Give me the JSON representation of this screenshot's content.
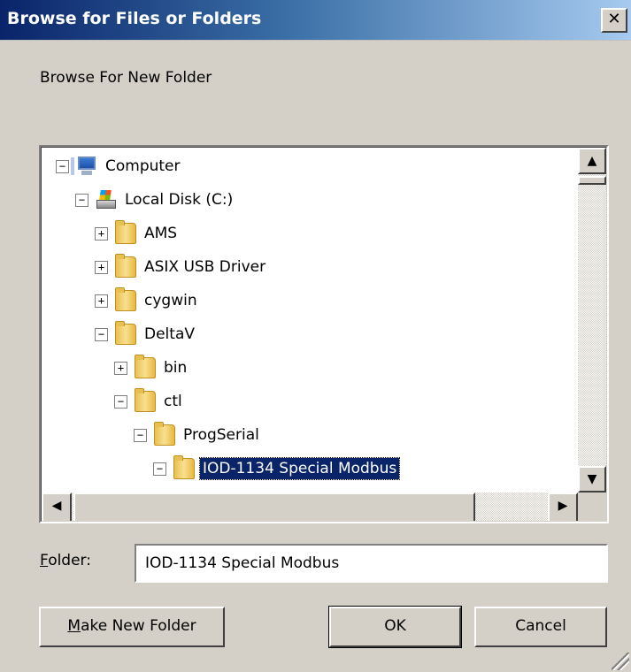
{
  "window": {
    "title": "Browse for Files or Folders",
    "close_glyph": "✕"
  },
  "instruction": "Browse For New Folder",
  "tree": {
    "nodes": [
      {
        "label": "Computer",
        "expander": "−",
        "icon": "computer-icon",
        "level": 0
      },
      {
        "label": "Local Disk (C:)",
        "expander": "−",
        "icon": "local-disk-icon",
        "level": 1
      },
      {
        "label": "AMS",
        "expander": "+",
        "icon": "folder-icon",
        "level": 2
      },
      {
        "label": "ASIX USB Driver",
        "expander": "+",
        "icon": "folder-icon",
        "level": 2
      },
      {
        "label": "cygwin",
        "expander": "+",
        "icon": "folder-icon",
        "level": 2
      },
      {
        "label": "DeltaV",
        "expander": "−",
        "icon": "folder-icon",
        "level": 2
      },
      {
        "label": "bin",
        "expander": "+",
        "icon": "folder-icon",
        "level": 3
      },
      {
        "label": "ctl",
        "expander": "−",
        "icon": "folder-icon",
        "level": 3
      },
      {
        "label": "ProgSerial",
        "expander": "−",
        "icon": "folder-icon",
        "level": 4
      },
      {
        "label": "IOD-1134 Special Modbus",
        "expander": "−",
        "icon": "folder-icon",
        "level": 5,
        "selected": true
      }
    ],
    "scroll_up_glyph": "▲",
    "scroll_down_glyph": "▼",
    "scroll_left_glyph": "◀",
    "scroll_right_glyph": "▶"
  },
  "folder_field": {
    "label_prefix": "F",
    "label_rest": "older:",
    "value": "IOD-1134 Special Modbus"
  },
  "buttons": {
    "make_new_folder_prefix": "M",
    "make_new_folder_rest": "ake New Folder",
    "ok": "OK",
    "cancel": "Cancel"
  }
}
